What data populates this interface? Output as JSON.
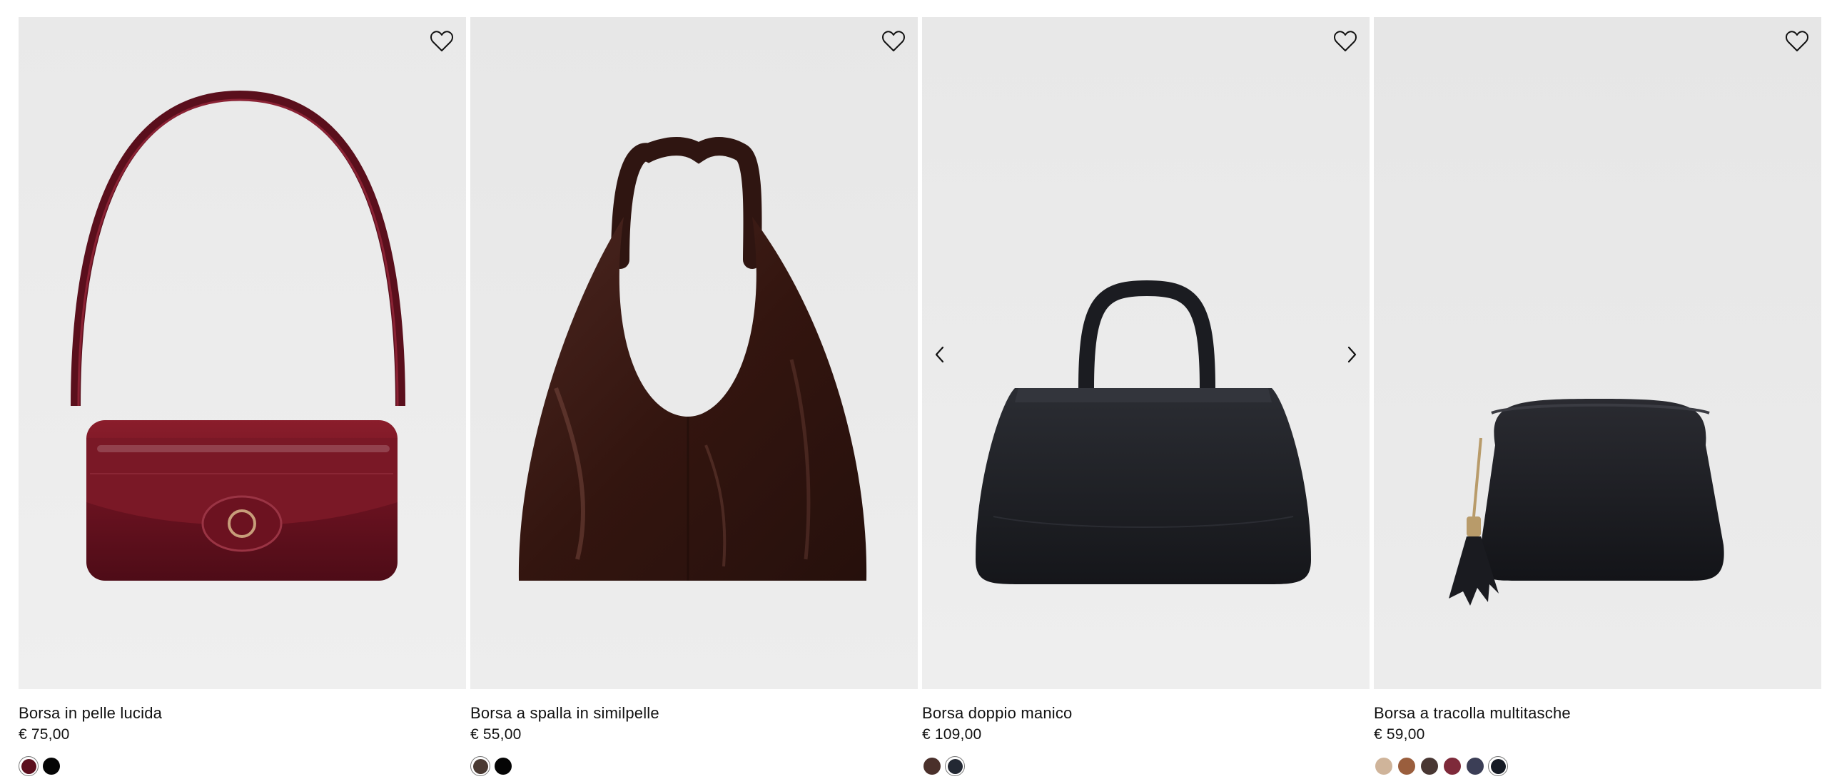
{
  "icons": {
    "wishlist": "heart-outline-icon",
    "prev": "chevron-left-icon",
    "next": "chevron-right-icon"
  },
  "products": [
    {
      "name": "Borsa in pelle lucida",
      "price": "€ 75,00",
      "bag_color": "#6e1522",
      "swatches": [
        "#5c0f1e",
        "#050505"
      ],
      "selected_swatch": 0,
      "carousel_arrows_visible": false
    },
    {
      "name": "Borsa a spalla in similpelle",
      "price": "€ 55,00",
      "bag_color": "#3a1b17",
      "swatches": [
        "#4a3a33",
        "#050505"
      ],
      "selected_swatch": 0,
      "carousel_arrows_visible": false
    },
    {
      "name": "Borsa doppio manico",
      "price": "€ 109,00",
      "bag_color": "#1e1f24",
      "swatches": [
        "#4a302b",
        "#232833"
      ],
      "selected_swatch": 1,
      "carousel_arrows_visible": true
    },
    {
      "name": "Borsa a tracolla multitasche",
      "price": "€ 59,00",
      "bag_color": "#1c1d22",
      "swatches": [
        "#cfb49a",
        "#9a5e3d",
        "#493733",
        "#7e2a3a",
        "#3b3e56",
        "#161b25"
      ],
      "selected_swatch": 5,
      "carousel_arrows_visible": false
    }
  ]
}
